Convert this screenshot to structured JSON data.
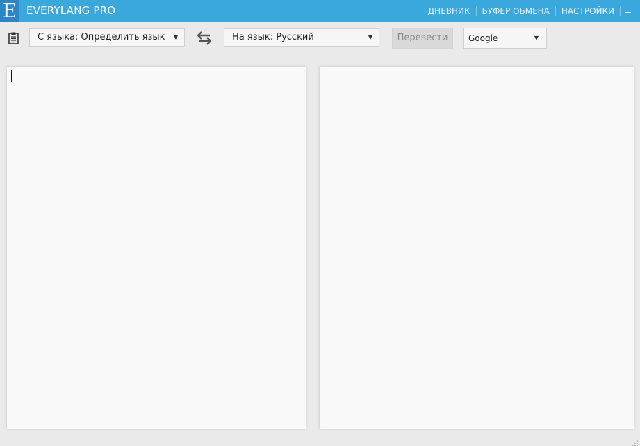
{
  "app": {
    "logo_letter": "E",
    "title": "EVERYLANG PRO"
  },
  "nav": {
    "diary": "ДНЕВНИК",
    "clipboard": "БУФЕР ОБМЕНА",
    "settings": "НАСТРОЙКИ"
  },
  "toolbar": {
    "from_language": "С языка: Определить язык",
    "to_language": "На язык: Русский",
    "translate_label": "Перевести",
    "engine": "Google"
  },
  "source": {
    "value": "",
    "placeholder": ""
  },
  "result": {
    "value": ""
  },
  "colors": {
    "titlebar": "#3aa8dc",
    "logo_bg": "#2a86c4",
    "background": "#eaeaea",
    "panel": "#f9f9f9"
  },
  "icons": {
    "clipboard": "clipboard-icon",
    "swap": "swap-arrows-icon",
    "minimize": "minimize-icon",
    "dropdown_arrow": "caret-down-icon"
  }
}
